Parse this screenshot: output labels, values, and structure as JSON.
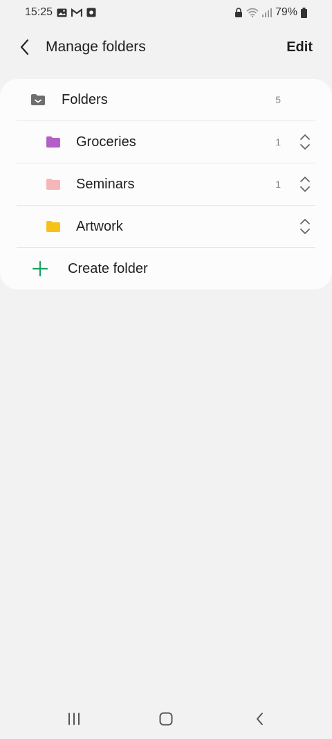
{
  "status_bar": {
    "time": "15:25",
    "battery": "79%",
    "left_icons": [
      "gallery-icon",
      "gmail-icon",
      "screenshot-icon"
    ],
    "right_icons": [
      "lock-icon",
      "wifi-icon",
      "signal-icon",
      "battery-icon"
    ]
  },
  "header": {
    "back_icon": "chevron-left-icon",
    "title": "Manage folders",
    "edit_label": "Edit"
  },
  "folders": {
    "root": {
      "label": "Folders",
      "count": "5",
      "icon": "folder-check-icon",
      "color": "#6e6e6e"
    },
    "items": [
      {
        "label": "Groceries",
        "count": "1",
        "color": "#b45fc7",
        "icon": "folder-icon",
        "reorder_icon": "reorder-icon"
      },
      {
        "label": "Seminars",
        "count": "1",
        "color": "#f4b6b6",
        "icon": "folder-icon",
        "reorder_icon": "reorder-icon"
      },
      {
        "label": "Artwork",
        "count": "",
        "color": "#f6c21a",
        "icon": "folder-icon",
        "reorder_icon": "reorder-icon"
      }
    ]
  },
  "create_folder": {
    "label": "Create folder",
    "icon": "plus-icon",
    "color": "#1aa260"
  },
  "nav_bar": {
    "icons": [
      "recents-icon",
      "home-icon",
      "back-icon"
    ]
  }
}
